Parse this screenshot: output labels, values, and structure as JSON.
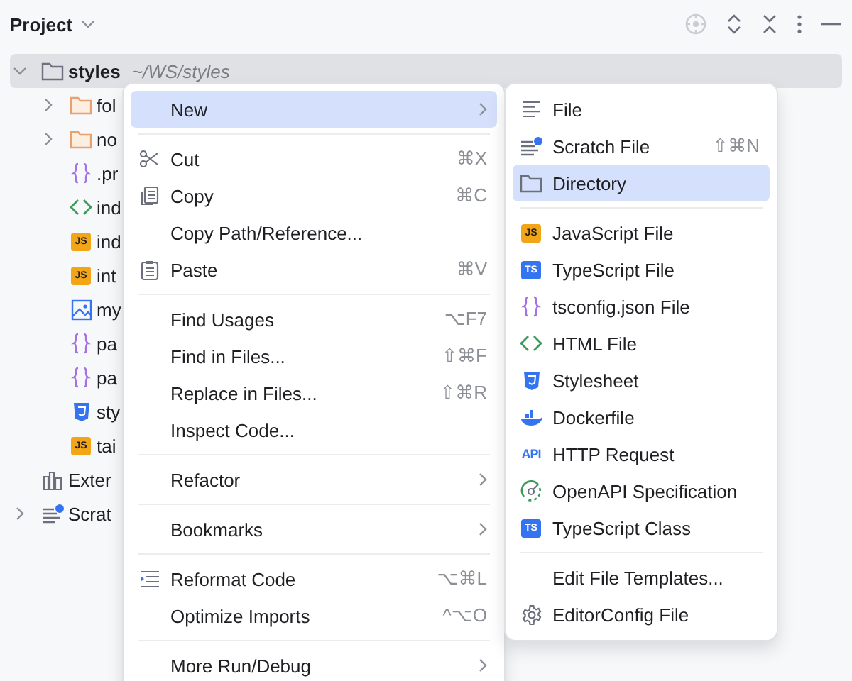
{
  "panel": {
    "title": "Project"
  },
  "tree": [
    {
      "label": "styles",
      "path": "~/WS/styles",
      "kind": "folder",
      "expanded": true,
      "selected": true,
      "children": [
        {
          "label": "fol",
          "kind": "orange-folder",
          "expanded": false
        },
        {
          "label": "no",
          "kind": "orange-folder",
          "expanded": false
        },
        {
          "label": ".pr",
          "kind": "braces"
        },
        {
          "label": "ind",
          "kind": "html"
        },
        {
          "label": "ind",
          "kind": "js",
          "badge": "JS"
        },
        {
          "label": "int",
          "kind": "js",
          "badge": "JS"
        },
        {
          "label": "my",
          "kind": "image"
        },
        {
          "label": "pa",
          "kind": "braces"
        },
        {
          "label": "pa",
          "kind": "braces"
        },
        {
          "label": "sty",
          "kind": "css"
        },
        {
          "label": "tai",
          "kind": "js",
          "badge": "JS"
        }
      ]
    },
    {
      "label": "Exter",
      "kind": "library"
    },
    {
      "label": "Scrat",
      "kind": "scratch",
      "expanded": false
    }
  ],
  "context_menu": [
    {
      "kind": "plain",
      "label": "New",
      "submenu": true,
      "selected": true
    },
    {
      "kind": "separator"
    },
    {
      "kind": "scissors",
      "label": "Cut",
      "shortcut": "⌘X",
      "selected": false
    },
    {
      "kind": "copy",
      "label": "Copy",
      "shortcut": "⌘C",
      "selected": false
    },
    {
      "kind": "plain",
      "label": "Copy Path/Reference...",
      "selected": false
    },
    {
      "kind": "paste",
      "label": "Paste",
      "shortcut": "⌘V",
      "selected": false
    },
    {
      "kind": "separator"
    },
    {
      "kind": "plain",
      "label": "Find Usages",
      "shortcut": "⌥F7",
      "selected": false
    },
    {
      "kind": "plain",
      "label": "Find in Files...",
      "shortcut": "⇧⌘F",
      "selected": false
    },
    {
      "kind": "plain",
      "label": "Replace in Files...",
      "shortcut": "⇧⌘R",
      "selected": false
    },
    {
      "kind": "plain",
      "label": "Inspect Code...",
      "selected": false
    },
    {
      "kind": "separator"
    },
    {
      "kind": "plain",
      "label": "Refactor",
      "submenu": true,
      "selected": false
    },
    {
      "kind": "separator"
    },
    {
      "kind": "plain",
      "label": "Bookmarks",
      "submenu": true,
      "selected": false
    },
    {
      "kind": "separator"
    },
    {
      "kind": "reformat",
      "label": "Reformat Code",
      "shortcut": "⌥⌘L",
      "selected": false
    },
    {
      "kind": "plain",
      "label": "Optimize Imports",
      "shortcut": "^⌥O",
      "selected": false
    },
    {
      "kind": "separator"
    },
    {
      "kind": "plain",
      "label": "More Run/Debug",
      "submenu": true,
      "selected": false
    }
  ],
  "new_submenu": [
    {
      "kind": "lines",
      "label": "File",
      "selected": false
    },
    {
      "kind": "scratch",
      "label": "Scratch File",
      "shortcut": "⇧⌘N",
      "selected": false
    },
    {
      "kind": "folder",
      "label": "Directory",
      "selected": true
    },
    {
      "kind": "separator"
    },
    {
      "kind": "js",
      "badge": "JS",
      "label": "JavaScript File",
      "selected": false
    },
    {
      "kind": "ts",
      "badge": "TS",
      "label": "TypeScript File",
      "selected": false
    },
    {
      "kind": "braces",
      "label": "tsconfig.json File",
      "selected": false
    },
    {
      "kind": "html",
      "label": "HTML File",
      "selected": false
    },
    {
      "kind": "css",
      "label": "Stylesheet",
      "selected": false
    },
    {
      "kind": "docker",
      "label": "Dockerfile",
      "selected": false
    },
    {
      "kind": "api",
      "badge": "API",
      "label": "HTTP Request",
      "selected": false
    },
    {
      "kind": "openapi",
      "label": "OpenAPI Specification",
      "selected": false
    },
    {
      "kind": "ts",
      "badge": "TS",
      "label": "TypeScript Class",
      "selected": false
    },
    {
      "kind": "separator"
    },
    {
      "kind": "plain",
      "label": "Edit File Templates...",
      "selected": false
    },
    {
      "kind": "gear",
      "label": "EditorConfig File",
      "selected": false
    }
  ]
}
